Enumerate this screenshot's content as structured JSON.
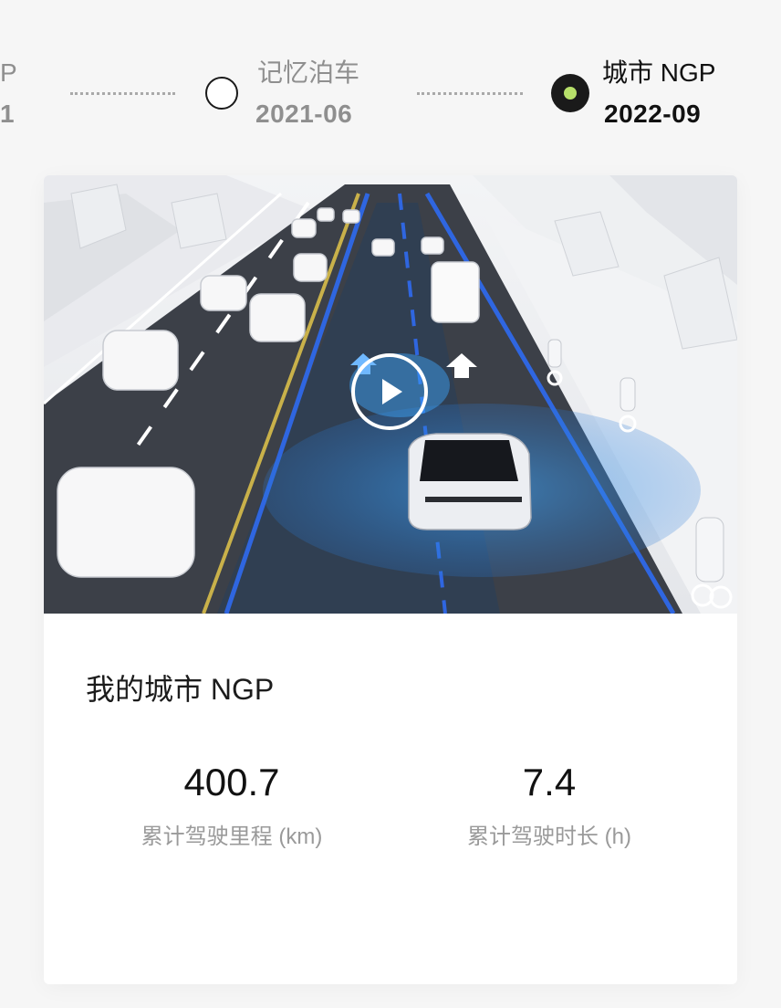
{
  "timeline": {
    "prev": {
      "title": "P",
      "date": "1"
    },
    "items": [
      {
        "title": "记忆泊车",
        "date": "2021-06",
        "state": "completed"
      },
      {
        "title": "城市 NGP",
        "date": "2022-09",
        "state": "current"
      }
    ],
    "active_dot_color": "#b7e06a"
  },
  "card": {
    "video": {
      "play_icon": "play-icon",
      "description_icon": "city-driving-scene"
    },
    "title": "我的城市 NGP",
    "stats": [
      {
        "value": "400.7",
        "label": "累计驾驶里程 (km)"
      },
      {
        "value": "7.4",
        "label": "累计驾驶时长 (h)"
      }
    ]
  },
  "colors": {
    "page_bg": "#f6f6f6",
    "card_bg": "#ffffff",
    "muted_text": "#8f8f8f",
    "primary_text": "#111111"
  }
}
